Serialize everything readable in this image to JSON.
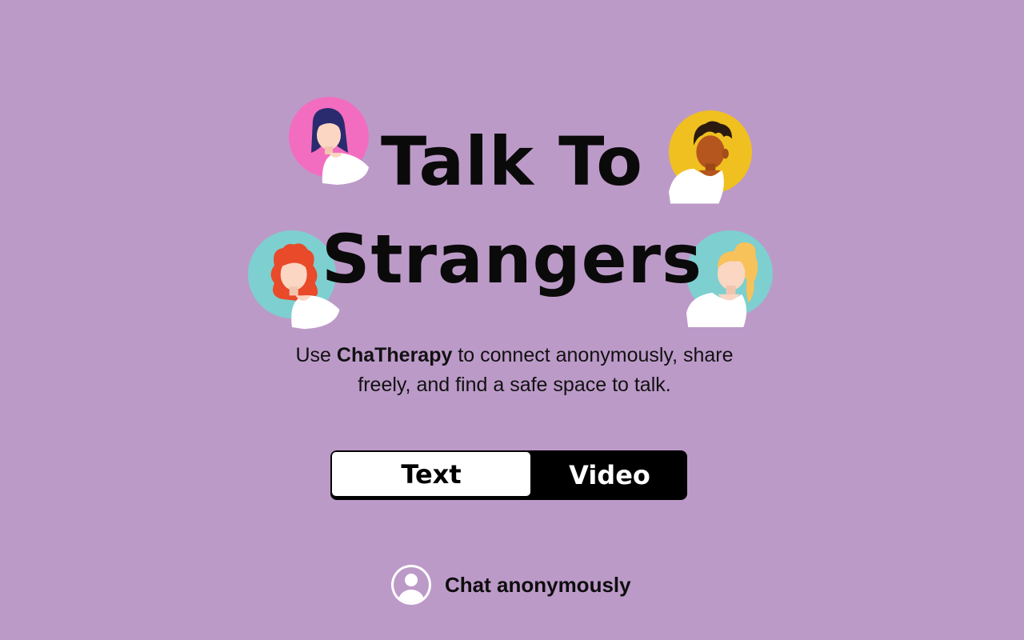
{
  "hero": {
    "title_line_1": "Talk To",
    "title_line_2": "Strangers"
  },
  "subtitle": {
    "prefix": "Use ",
    "brand": "ChaTherapy",
    "suffix": " to connect anonymously, share freely, and find a safe space to talk."
  },
  "mode_toggle": {
    "text_label": "Text",
    "video_label": "Video",
    "selected": "Text"
  },
  "anonymous": {
    "label": "Chat anonymously",
    "icon": "user-circle-icon"
  },
  "avatars": [
    {
      "name": "avatar-woman-navy-hair",
      "bg": "#f26dbf"
    },
    {
      "name": "avatar-man-dark-skin",
      "bg": "#f0c020"
    },
    {
      "name": "avatar-woman-red-hair",
      "bg": "#7ecfcf"
    },
    {
      "name": "avatar-woman-blonde-hair",
      "bg": "#7ecfcf"
    }
  ],
  "colors": {
    "background": "#bc9ac8",
    "text": "#0a0a0a",
    "toggle_dark": "#000000",
    "toggle_light": "#ffffff"
  }
}
